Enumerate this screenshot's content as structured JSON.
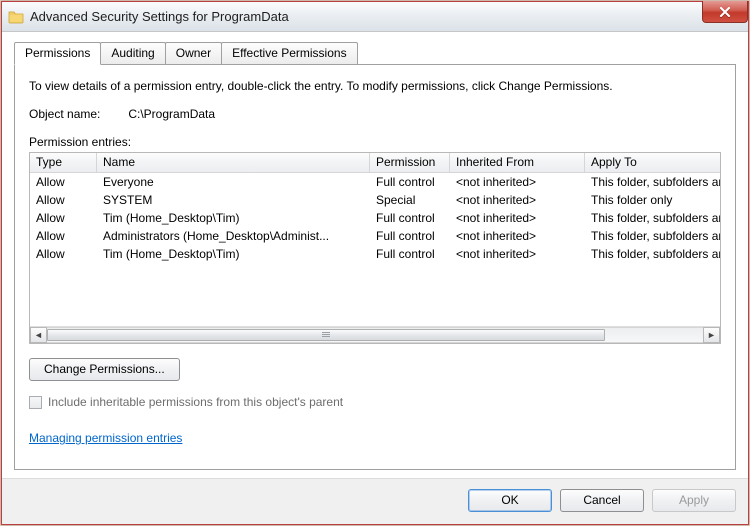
{
  "window": {
    "title": "Advanced Security Settings for ProgramData"
  },
  "tabs": [
    {
      "label": "Permissions",
      "active": true
    },
    {
      "label": "Auditing",
      "active": false
    },
    {
      "label": "Owner",
      "active": false
    },
    {
      "label": "Effective Permissions",
      "active": false
    }
  ],
  "panel": {
    "instruction": "To view details of a permission entry, double-click the entry. To modify permissions, click Change Permissions.",
    "object_label": "Object name:",
    "object_value": "C:\\ProgramData",
    "entries_label": "Permission entries:",
    "columns": {
      "type": "Type",
      "name": "Name",
      "permission": "Permission",
      "inherited": "Inherited From",
      "apply": "Apply To"
    },
    "rows": [
      {
        "type": "Allow",
        "name": "Everyone",
        "permission": "Full control",
        "inherited": "<not inherited>",
        "apply": "This folder, subfolders and fi"
      },
      {
        "type": "Allow",
        "name": "SYSTEM",
        "permission": "Special",
        "inherited": "<not inherited>",
        "apply": "This folder only"
      },
      {
        "type": "Allow",
        "name": "Tim (Home_Desktop\\Tim)",
        "permission": "Full control",
        "inherited": "<not inherited>",
        "apply": "This folder, subfolders and fi"
      },
      {
        "type": "Allow",
        "name": "Administrators (Home_Desktop\\Administ...",
        "permission": "Full control",
        "inherited": "<not inherited>",
        "apply": "This folder, subfolders and fi"
      },
      {
        "type": "Allow",
        "name": "Tim (Home_Desktop\\Tim)",
        "permission": "Full control",
        "inherited": "<not inherited>",
        "apply": "This folder, subfolders and fi"
      }
    ],
    "change_permissions": "Change Permissions...",
    "inherit_checkbox": "Include inheritable permissions from this object's parent",
    "link": "Managing permission entries"
  },
  "buttons": {
    "ok": "OK",
    "cancel": "Cancel",
    "apply": "Apply"
  }
}
